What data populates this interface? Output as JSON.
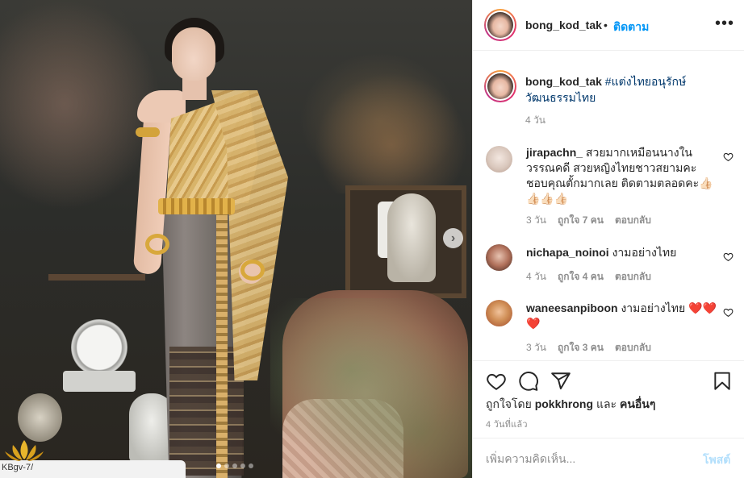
{
  "post": {
    "username": "bong_kod_tak",
    "separator": "•",
    "follow_label": "ติดตาม",
    "more_icon": "more-horizontal-icon",
    "caption_user": "bong_kod_tak",
    "caption_text": "#แต่งไทยอนุรักษ์วัฒนธรรมไทย",
    "caption_time": "4 วัน",
    "image_alt": "ผู้หญิงในชุดไทยสีทอง",
    "carousel": {
      "total_slides": 5,
      "active_slide": 1
    },
    "watermark_text": "KBgv-7/"
  },
  "comments": [
    {
      "username": "jirapachn_",
      "text": "สวยมากเหมือนนางในวรรณคดี สวยหญิงไทยชาวสยามคะ ชอบคุณตั้กมากเลย ติดตามตลอดคะ👍🏻👍🏻👍🏻👍🏻",
      "time": "3 วัน",
      "likes": "ถูกใจ 7 คน",
      "reply": "ตอบกลับ"
    },
    {
      "username": "nichapa_noinoi",
      "text": "งามอย่างไทย",
      "time": "4 วัน",
      "likes": "ถูกใจ 4 คน",
      "reply": "ตอบกลับ"
    },
    {
      "username": "waneesanpiboon",
      "text": "งามอย่างไทย ❤️❤️❤️",
      "time": "3 วัน",
      "likes": "ถูกใจ 3 คน",
      "reply": "ตอบกลับ"
    }
  ],
  "actions": {
    "liked_by_prefix": "ถูกใจโดย",
    "liked_by_user": "pokkhrong",
    "liked_by_and": "และ",
    "liked_by_others": "คนอื่นๆ",
    "post_time": "4 วันที่แล้ว"
  },
  "add_comment": {
    "placeholder": "เพิ่มความคิดเห็น...",
    "post_label": "โพสต์"
  },
  "colors": {
    "accent": "#0095f6",
    "hashtag": "#00376b",
    "muted": "#8e8e8e",
    "post_disabled": "#b2dffc"
  }
}
